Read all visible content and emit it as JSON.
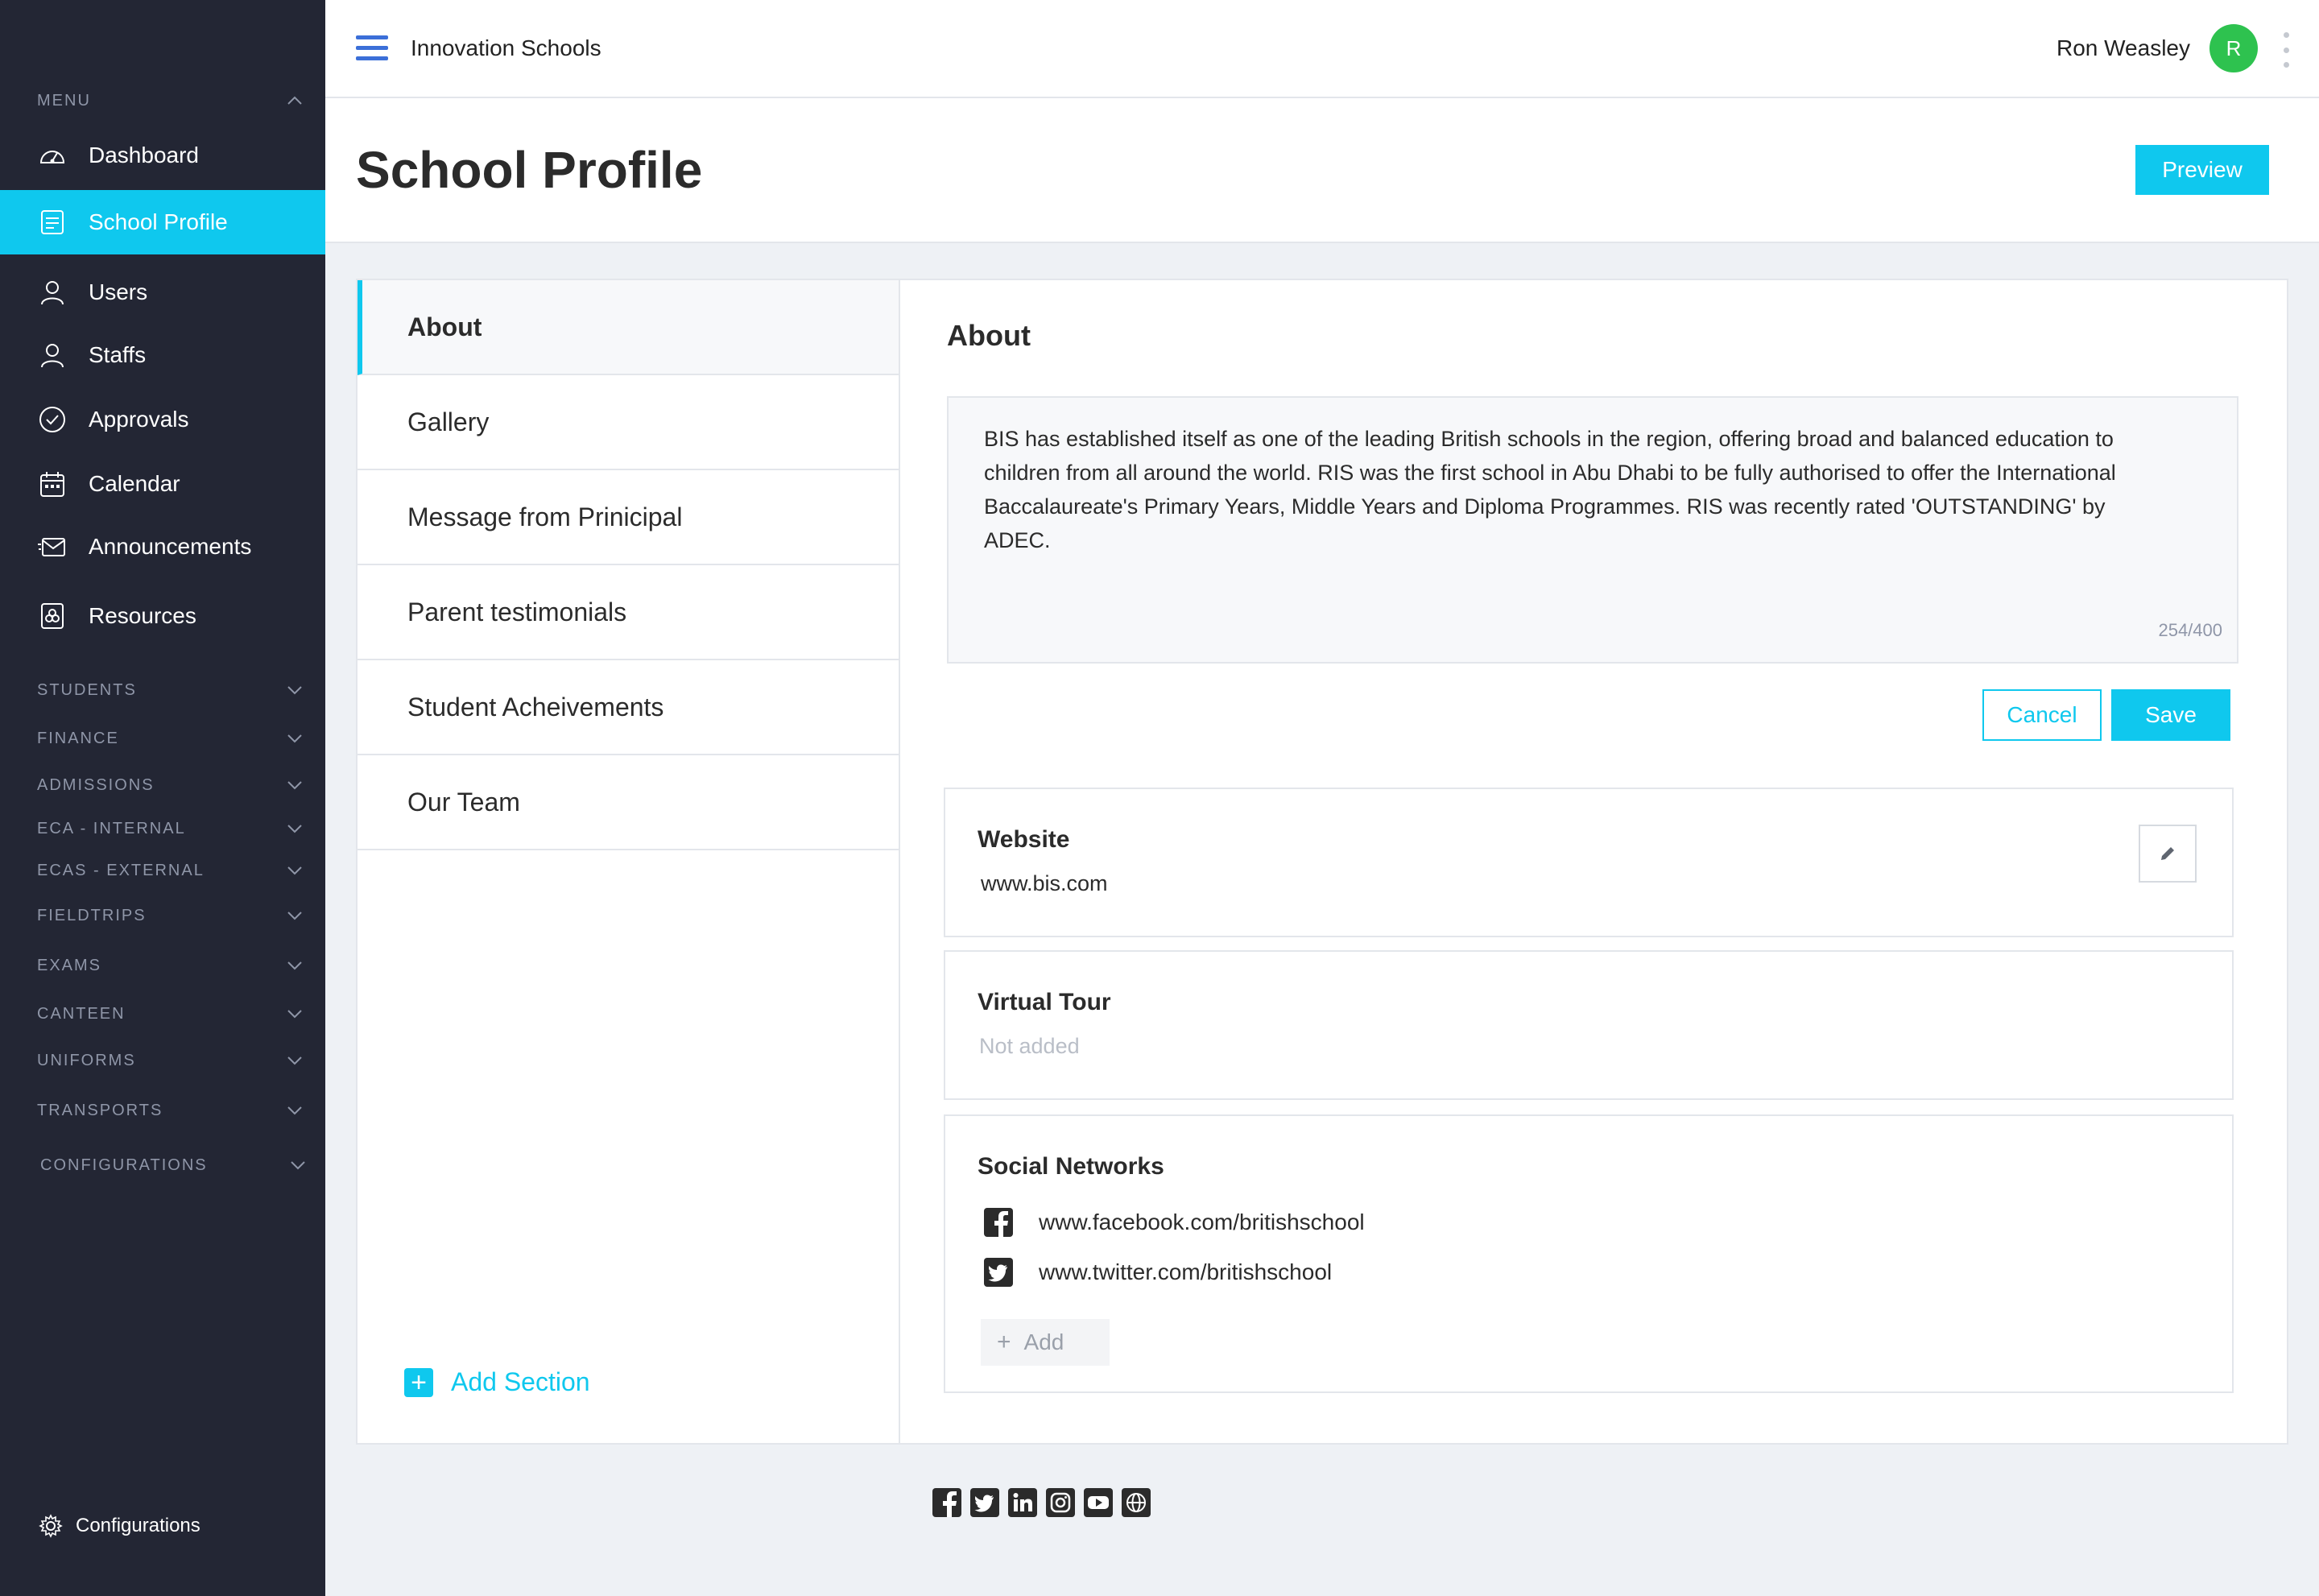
{
  "sidebar": {
    "menu_header": "MENU",
    "items": [
      {
        "label": "Dashboard",
        "icon": "dashboard-icon"
      },
      {
        "label": "School Profile",
        "icon": "school-profile-icon"
      },
      {
        "label": "Users",
        "icon": "user-icon"
      },
      {
        "label": "Staffs",
        "icon": "user-icon"
      },
      {
        "label": "Approvals",
        "icon": "check-circle-icon"
      },
      {
        "label": "Calendar",
        "icon": "calendar-icon"
      },
      {
        "label": "Announcements",
        "icon": "envelope-icon"
      },
      {
        "label": "Resources",
        "icon": "resources-icon"
      }
    ],
    "active_item": "School Profile",
    "sections": [
      "STUDENTS",
      "FINANCE",
      "ADMISSIONS",
      "ECA - INTERNAL",
      "ECAS - EXTERNAL",
      "FIELDTRIPS",
      "EXAMS",
      "CANTEEN",
      "UNIFORMS",
      "TRANSPORTS",
      "CONFIGURATIONS"
    ],
    "footer_label": "Configurations"
  },
  "topbar": {
    "app_title": "Innovation Schools",
    "user_name": "Ron Weasley",
    "avatar_initial": "R"
  },
  "header": {
    "title": "School Profile",
    "preview_label": "Preview"
  },
  "sections_list": {
    "items": [
      "About",
      "Gallery",
      "Message from Prinicipal",
      "Parent testimonials",
      "Student Acheivements",
      "Our Team"
    ],
    "active": "About",
    "add_label": "Add Section"
  },
  "about": {
    "title": "About",
    "text": "BIS has established itself as one of the leading British schools in the region, offering broad and balanced education to children from all around the world.  RIS was the first school in Abu Dhabi to be fully authorised to offer the International Baccalaureate's Primary Years, Middle Years and Diploma Programmes. RIS was recently rated 'OUTSTANDING' by ADEC.",
    "counter": "254/400",
    "cancel_label": "Cancel",
    "save_label": "Save"
  },
  "website": {
    "title": "Website",
    "value": "www.bis.com"
  },
  "virtual_tour": {
    "title": "Virtual Tour",
    "value": "Not added"
  },
  "social": {
    "title": "Social Networks",
    "items": [
      {
        "icon": "facebook-icon",
        "url": "www.facebook.com/britishschool"
      },
      {
        "icon": "twitter-icon",
        "url": "www.twitter.com/britishschool"
      }
    ],
    "add_label": "Add"
  },
  "footer_icons": [
    "facebook-icon",
    "twitter-icon",
    "linkedin-icon",
    "instagram-icon",
    "youtube-icon",
    "globe-icon"
  ],
  "colors": {
    "accent": "#0fc8ee",
    "sidebar_bg": "#232634",
    "avatar": "#2ec24f",
    "hamburger": "#3b6fd8"
  }
}
